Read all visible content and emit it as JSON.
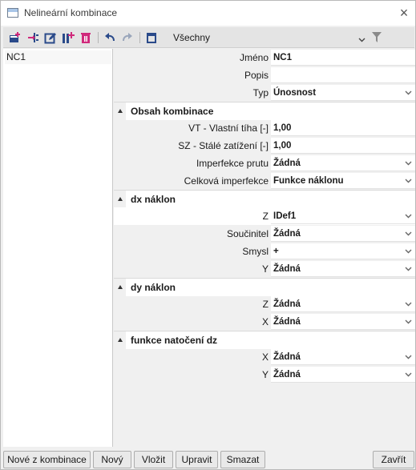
{
  "window": {
    "title": "Nelineární kombinace",
    "close_icon": "close-icon"
  },
  "toolbar": {
    "icons": [
      "new-icon",
      "insert-icon",
      "edit-icon",
      "copy-icon",
      "delete-icon",
      "undo-icon",
      "redo-icon",
      "table-icon"
    ],
    "filter_value": "Všechny",
    "filter_icon": "funnel-icon"
  },
  "list": {
    "items": [
      "NC1"
    ]
  },
  "props": {
    "name": {
      "label": "Jméno",
      "value": "NC1"
    },
    "description": {
      "label": "Popis",
      "value": ""
    },
    "type": {
      "label": "Typ",
      "value": "Únosnost"
    },
    "section_content": "Obsah kombinace",
    "vt": {
      "label": "VT - Vlastní tíha [-]",
      "value": "1,00"
    },
    "sz": {
      "label": "SZ - Stálé zatížení [-]",
      "value": "1,00"
    },
    "member_imperfection": {
      "label": "Imperfekce prutu",
      "value": "Žádná"
    },
    "global_imperfection": {
      "label": "Celková imperfekce",
      "value": "Funkce náklonu"
    },
    "section_dx": "dx náklon",
    "dx_z": {
      "label": "Z",
      "value": "IDef1"
    },
    "dx_coef": {
      "label": "Součinitel",
      "value": "Žádná"
    },
    "dx_sense": {
      "label": "Smysl",
      "value": "+"
    },
    "dx_y": {
      "label": "Y",
      "value": "Žádná"
    },
    "section_dy": "dy náklon",
    "dy_z": {
      "label": "Z",
      "value": "Žádná"
    },
    "dy_x": {
      "label": "X",
      "value": "Žádná"
    },
    "section_rot": "funkce natočení dz",
    "rot_x": {
      "label": "X",
      "value": "Žádná"
    },
    "rot_y": {
      "label": "Y",
      "value": "Žádná"
    }
  },
  "buttons": {
    "new_from_combination": "Nové z kombinace",
    "new": "Nový",
    "insert": "Vložit",
    "edit": "Upravit",
    "delete": "Smazat",
    "close": "Zavřít"
  }
}
